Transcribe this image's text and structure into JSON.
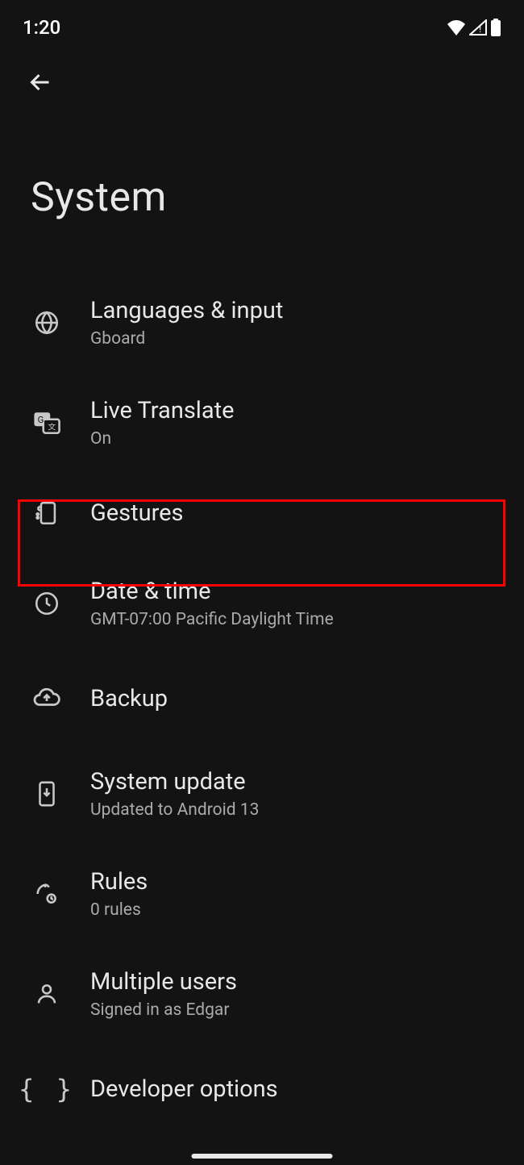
{
  "status": {
    "time": "1:20"
  },
  "page": {
    "title": "System"
  },
  "items": {
    "languages": {
      "label": "Languages & input",
      "sub": "Gboard"
    },
    "live_translate": {
      "label": "Live Translate",
      "sub": "On"
    },
    "gestures": {
      "label": "Gestures"
    },
    "date_time": {
      "label": "Date & time",
      "sub": "GMT-07:00 Pacific Daylight Time"
    },
    "backup": {
      "label": "Backup"
    },
    "system_update": {
      "label": "System update",
      "sub": "Updated to Android 13"
    },
    "rules": {
      "label": "Rules",
      "sub": "0 rules"
    },
    "multiple_users": {
      "label": "Multiple users",
      "sub": "Signed in as Edgar"
    },
    "developer_options": {
      "label": "Developer options"
    }
  },
  "highlighted_item": "gestures"
}
